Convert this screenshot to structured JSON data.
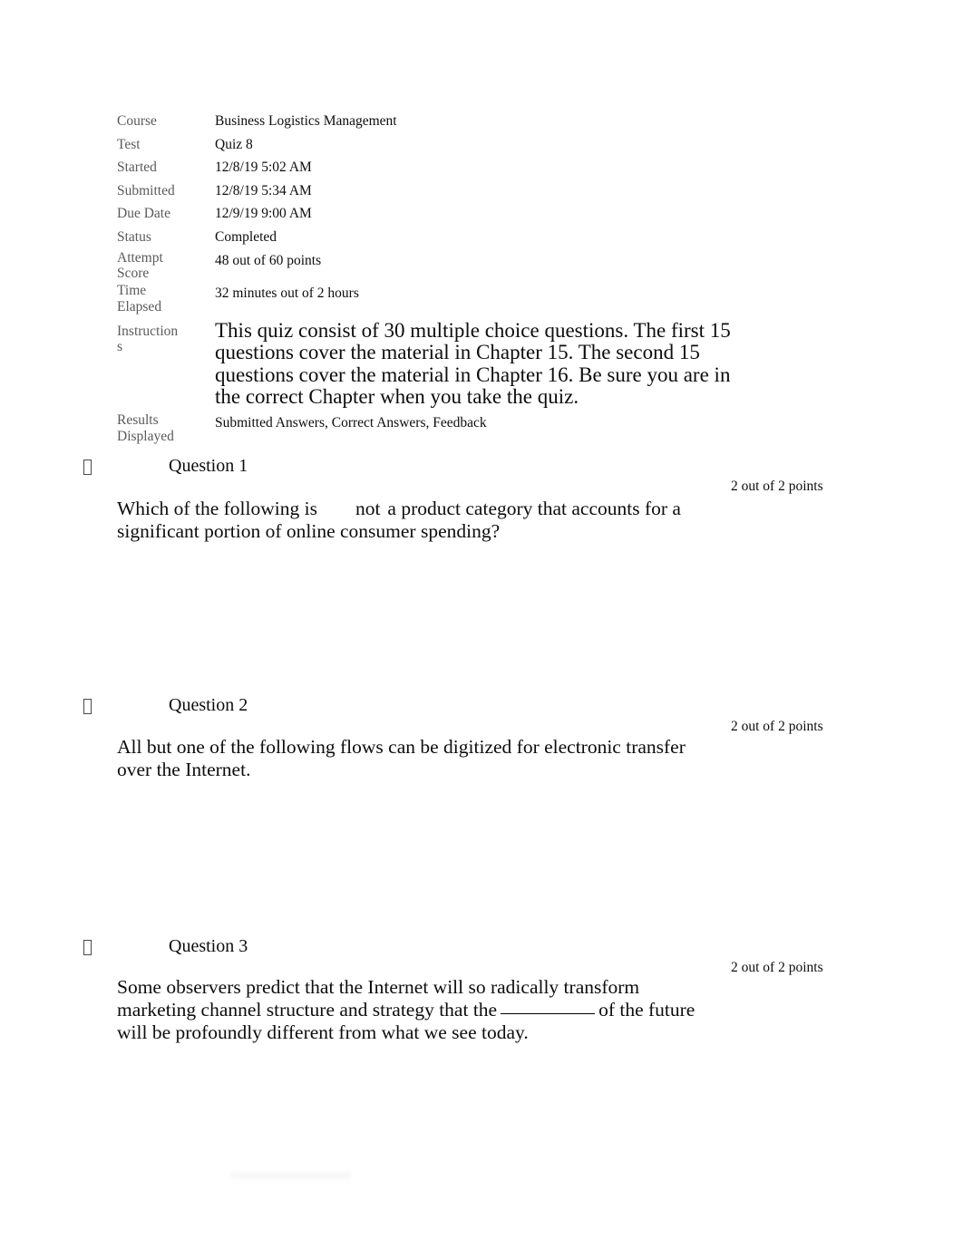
{
  "meta": {
    "rows": [
      {
        "label": "Course",
        "value": "Business Logistics Management"
      },
      {
        "label": "Test",
        "value": "Quiz 8"
      },
      {
        "label": "Started",
        "value": "12/8/19 5:02 AM"
      },
      {
        "label": "Submitted",
        "value": "12/8/19 5:34 AM"
      },
      {
        "label": "Due Date",
        "value": "12/9/19 9:00 AM"
      },
      {
        "label": "Status",
        "value": "Completed"
      },
      {
        "label_line1": "Attempt",
        "label_line2": "Score",
        "value": "48 out of 60 points"
      },
      {
        "label_line1": "Time",
        "label_line2": "Elapsed",
        "value": "32 minutes out of 2 hours"
      },
      {
        "label_line1": "Instruction",
        "label_line2": "s",
        "value": "This quiz consist of 30 multiple choice questions. The first 15 questions cover the material in Chapter 15. The second 15 questions cover the material in Chapter 16. Be sure you are in the correct Chapter when you take the quiz."
      },
      {
        "label_line1": "Results",
        "label_line2": "Displayed",
        "value": "Submitted Answers, Correct Answers, Feedback"
      }
    ]
  },
  "questions": [
    {
      "title": "Question 1",
      "points": "2 out of 2 points",
      "body_part1": "Which of the following is",
      "body_emphasis": "not",
      "body_part2": "a product category that accounts for a significant portion of online consumer spending?"
    },
    {
      "title": "Question 2",
      "points": "2 out of 2 points",
      "body_part1": "All but one of the following flows can be digitized for electronic transfer over the Internet.",
      "body_emphasis": "",
      "body_part2": ""
    },
    {
      "title": "Question 3",
      "points": "2 out of 2 points",
      "body_part1": "Some observers predict that the Internet will so radically transform marketing channel structure and strategy that the",
      "body_emphasis": "",
      "body_part2": "of the future will be profoundly different from what we see today."
    }
  ]
}
